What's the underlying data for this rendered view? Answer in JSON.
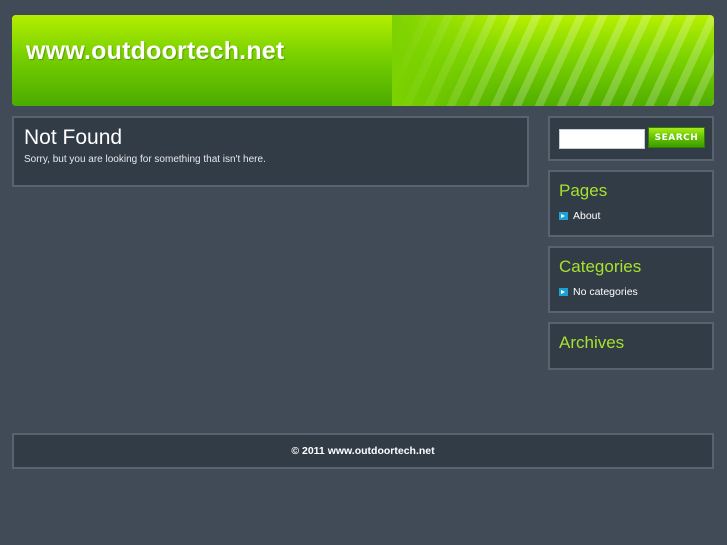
{
  "header": {
    "site_title": "www.outdoortech.net"
  },
  "main": {
    "heading": "Not Found",
    "message": "Sorry, but you are looking for something that isn't here."
  },
  "sidebar": {
    "search": {
      "value": "",
      "button_label": "SEARCH"
    },
    "pages": {
      "title": "Pages",
      "items": [
        {
          "label": "About"
        }
      ]
    },
    "categories": {
      "title": "Categories",
      "items": [
        {
          "label": "No categories"
        }
      ]
    },
    "archives": {
      "title": "Archives"
    }
  },
  "footer": {
    "copyright": "© 2011 www.outdoortech.net"
  },
  "colors": {
    "background": "#414b57",
    "panel": "#323c47",
    "accent_green": "#a6e22e",
    "bullet_blue": "#1aa2d6"
  },
  "icons": {
    "list_bullet": "arrow-right-icon"
  }
}
